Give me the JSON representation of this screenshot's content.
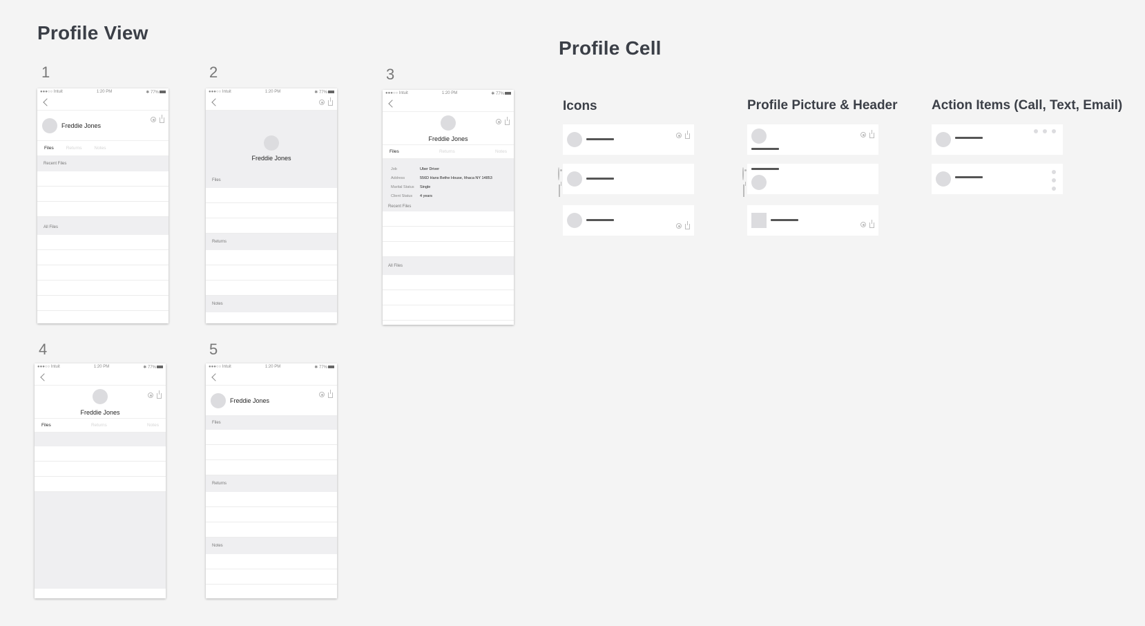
{
  "sections": {
    "profile_view": "Profile View",
    "profile_cell": "Profile Cell"
  },
  "cell_groups": {
    "icons": "Icons",
    "picture_header": "Profile Picture & Header",
    "action_items": "Action Items (Call, Text, Email)"
  },
  "status_bar": {
    "carrier": "●●●○○ Intuit",
    "time": "1:20 PM",
    "battery": "✱ 77%"
  },
  "profile": {
    "name": "Freddie Jones"
  },
  "tabs": {
    "files": "Files",
    "returns": "Returns",
    "notes": "Notes"
  },
  "lists": {
    "recent_files": "Recent Files",
    "all_files": "All Files",
    "files": "Files",
    "returns": "Returns",
    "notes": "Notes"
  },
  "details": {
    "job_label": "Job",
    "job_value": "Uber Driver",
    "address_label": "Address",
    "address_value": "556D Hans Bethe House, Ithaca NY 14853",
    "marital_label": "Marital Status",
    "marital_value": "Single",
    "client_label": "Client Status",
    "client_value": "4 years"
  },
  "screens": [
    {
      "number": "1"
    },
    {
      "number": "2"
    },
    {
      "number": "3"
    },
    {
      "number": "4"
    },
    {
      "number": "5"
    }
  ]
}
